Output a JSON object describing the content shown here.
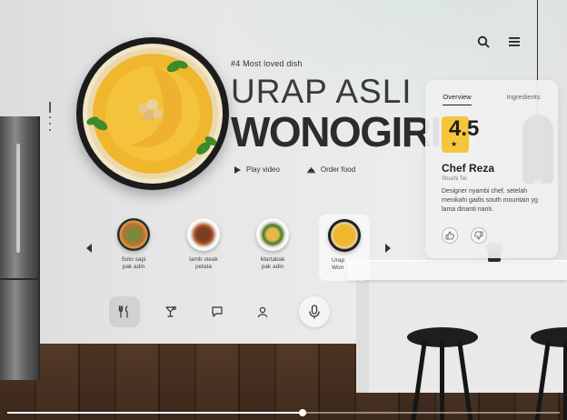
{
  "header": {
    "menu_icon": "hamburger-menu-icon",
    "search_icon": "search-icon"
  },
  "hero": {
    "tag": "#4 Most loved dish",
    "title_line1": "URAP ASLI",
    "title_line2": "WONOGIRI",
    "play_label": "Play video",
    "order_label": "Order food"
  },
  "carousel": {
    "items": [
      {
        "label": "Soto sapi\npak adin"
      },
      {
        "label": "Iamb steak\npetata"
      },
      {
        "label": "Martabak\npak adin"
      },
      {
        "label": "Urap\nWon"
      }
    ],
    "active_index": 3
  },
  "toolbar": {
    "items": [
      "utensils-icon",
      "cocktail-icon",
      "chat-icon",
      "user-icon",
      "microphone-icon"
    ],
    "selected": "utensils-icon"
  },
  "panel": {
    "tabs": [
      "Overview",
      "Ingredients"
    ],
    "active_tab": "Overview",
    "rating": "4.5",
    "rating_star": "★",
    "chef_name": "Chef Reza",
    "chef_role": "Shushi Tei",
    "chef_bio": "Designer nyambi chef, setelah menikahi gadis south mountain yg lama dinanti nanti."
  },
  "video_progress": 0.535,
  "colors": {
    "accent": "#f6c63a",
    "dark": "#2c2c2c"
  }
}
